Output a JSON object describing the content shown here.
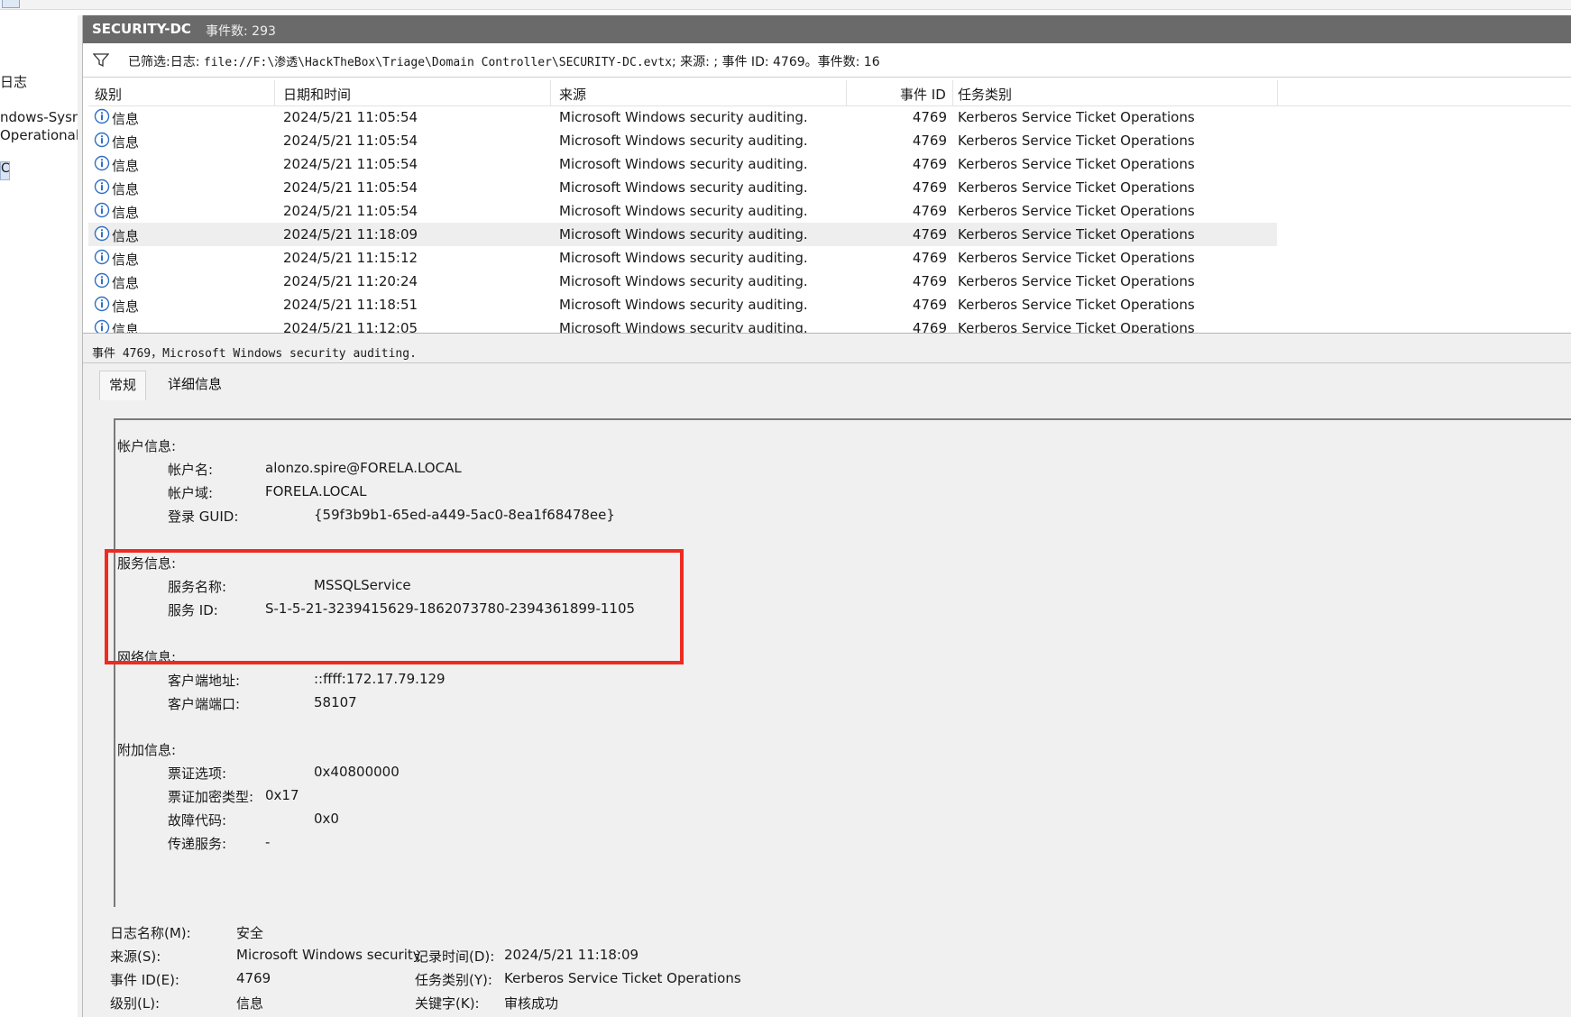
{
  "left_tree": {
    "items": [
      "日志",
      "ndows-Sysm",
      "Operational",
      "C"
    ]
  },
  "header": {
    "log_name": "SECURITY-DC",
    "event_count": "事件数: 293"
  },
  "filter": {
    "prefix": "已筛选:日志: ",
    "path": "file://F:\\渗透\\HackTheBox\\Triage\\Domain Controller\\SECURITY-DC.evtx",
    "middle": "; 来源: ; 事件 ID: 4769。事件数: 16"
  },
  "table": {
    "columns": [
      "级别",
      "日期和时间",
      "来源",
      "事件 ID",
      "任务类别"
    ],
    "rows": [
      {
        "level": "信息",
        "date": "2024/5/21 11:05:54",
        "source": "Microsoft Windows security auditing.",
        "id": "4769",
        "task": "Kerberos Service Ticket Operations"
      },
      {
        "level": "信息",
        "date": "2024/5/21 11:05:54",
        "source": "Microsoft Windows security auditing.",
        "id": "4769",
        "task": "Kerberos Service Ticket Operations"
      },
      {
        "level": "信息",
        "date": "2024/5/21 11:05:54",
        "source": "Microsoft Windows security auditing.",
        "id": "4769",
        "task": "Kerberos Service Ticket Operations"
      },
      {
        "level": "信息",
        "date": "2024/5/21 11:05:54",
        "source": "Microsoft Windows security auditing.",
        "id": "4769",
        "task": "Kerberos Service Ticket Operations"
      },
      {
        "level": "信息",
        "date": "2024/5/21 11:05:54",
        "source": "Microsoft Windows security auditing.",
        "id": "4769",
        "task": "Kerberos Service Ticket Operations"
      },
      {
        "level": "信息",
        "date": "2024/5/21 11:18:09",
        "source": "Microsoft Windows security auditing.",
        "id": "4769",
        "task": "Kerberos Service Ticket Operations"
      },
      {
        "level": "信息",
        "date": "2024/5/21 11:15:12",
        "source": "Microsoft Windows security auditing.",
        "id": "4769",
        "task": "Kerberos Service Ticket Operations"
      },
      {
        "level": "信息",
        "date": "2024/5/21 11:20:24",
        "source": "Microsoft Windows security auditing.",
        "id": "4769",
        "task": "Kerberos Service Ticket Operations"
      },
      {
        "level": "信息",
        "date": "2024/5/21 11:18:51",
        "source": "Microsoft Windows security auditing.",
        "id": "4769",
        "task": "Kerberos Service Ticket Operations"
      },
      {
        "level": "信息",
        "date": "2024/5/21 11:12:05",
        "source": "Microsoft Windows security auditing.",
        "id": "4769",
        "task": "Kerberos Service Ticket Operations"
      }
    ]
  },
  "details": {
    "title": "事件 4769，Microsoft Windows security auditing.",
    "tabs": [
      "常规",
      "详细信息"
    ],
    "account_section": "帐户信息:",
    "account_name_label": "帐户名:",
    "account_name": "alonzo.spire@FORELA.LOCAL",
    "account_domain_label": "帐户域:",
    "account_domain": "FORELA.LOCAL",
    "logon_guid_label": "登录 GUID:",
    "logon_guid": "{59f3b9b1-65ed-a449-5ac0-8ea1f68478ee}",
    "service_section": "服务信息:",
    "service_name_label": "服务名称:",
    "service_name": "MSSQLService",
    "service_id_label": "服务 ID:",
    "service_id": "S-1-5-21-3239415629-1862073780-2394361899-1105",
    "network_section": "网络信息:",
    "client_addr_label": "客户端地址:",
    "client_addr": "::ffff:172.17.79.129",
    "client_port_label": "客户端端口:",
    "client_port": "58107",
    "additional_section": "附加信息:",
    "ticket_options_label": "票证选项:",
    "ticket_options": "0x40800000",
    "ticket_enc_label": "票证加密类型:",
    "ticket_enc": "0x17",
    "failure_code_label": "故障代码:",
    "failure_code": "0x0",
    "transited_label": "传递服务:",
    "transited": "-"
  },
  "meta": {
    "log_name_label": "日志名称(M):",
    "log_name": "安全",
    "source_label": "来源(S):",
    "source": "Microsoft Windows security",
    "logged_label": "记录时间(D):",
    "logged": "2024/5/21 11:18:09",
    "event_id_label": "事件 ID(E):",
    "event_id": "4769",
    "task_label": "任务类别(Y):",
    "task": "Kerberos Service Ticket Operations",
    "level_label": "级别(L):",
    "level": "信息",
    "keywords_label": "关键字(K):",
    "keywords": "审核成功"
  },
  "colors": {
    "header_bg": "#6a6a6a",
    "highlight_box": "#ef2b20",
    "info_icon": "#2f6fc4",
    "selected_row": "#eeeeee"
  }
}
